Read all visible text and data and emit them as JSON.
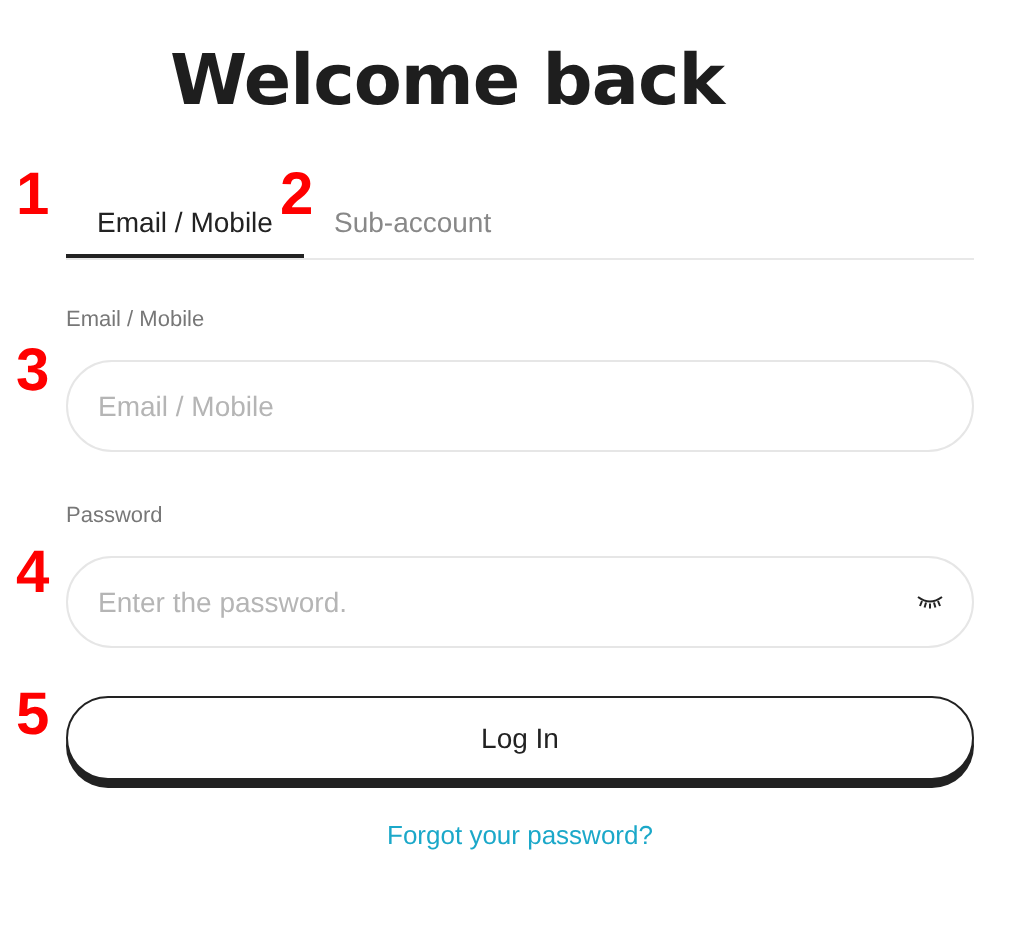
{
  "title": "Welcome back",
  "tabs": [
    {
      "label": "Email / Mobile",
      "selected": true,
      "marker": "1"
    },
    {
      "label": "Sub-account",
      "selected": false,
      "marker": "2"
    }
  ],
  "fields": [
    {
      "label": "Email / Mobile",
      "placeholder": "Email / Mobile",
      "kind": "text",
      "marker": "3"
    },
    {
      "label": "Password",
      "placeholder": "Enter the password.",
      "kind": "password",
      "marker": "4"
    }
  ],
  "login_button": {
    "label": "Log In",
    "marker": "5"
  },
  "forgot_link": "Forgot your password?"
}
